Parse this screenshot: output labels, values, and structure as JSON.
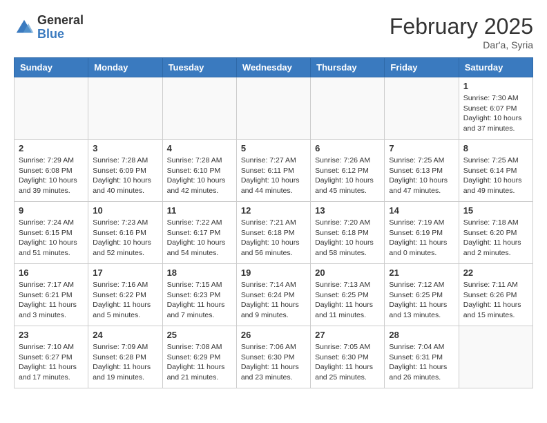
{
  "header": {
    "logo_general": "General",
    "logo_blue": "Blue",
    "month_year": "February 2025",
    "location": "Dar'a, Syria"
  },
  "weekdays": [
    "Sunday",
    "Monday",
    "Tuesday",
    "Wednesday",
    "Thursday",
    "Friday",
    "Saturday"
  ],
  "weeks": [
    [
      {
        "day": "",
        "info": ""
      },
      {
        "day": "",
        "info": ""
      },
      {
        "day": "",
        "info": ""
      },
      {
        "day": "",
        "info": ""
      },
      {
        "day": "",
        "info": ""
      },
      {
        "day": "",
        "info": ""
      },
      {
        "day": "1",
        "info": "Sunrise: 7:30 AM\nSunset: 6:07 PM\nDaylight: 10 hours\nand 37 minutes."
      }
    ],
    [
      {
        "day": "2",
        "info": "Sunrise: 7:29 AM\nSunset: 6:08 PM\nDaylight: 10 hours\nand 39 minutes."
      },
      {
        "day": "3",
        "info": "Sunrise: 7:28 AM\nSunset: 6:09 PM\nDaylight: 10 hours\nand 40 minutes."
      },
      {
        "day": "4",
        "info": "Sunrise: 7:28 AM\nSunset: 6:10 PM\nDaylight: 10 hours\nand 42 minutes."
      },
      {
        "day": "5",
        "info": "Sunrise: 7:27 AM\nSunset: 6:11 PM\nDaylight: 10 hours\nand 44 minutes."
      },
      {
        "day": "6",
        "info": "Sunrise: 7:26 AM\nSunset: 6:12 PM\nDaylight: 10 hours\nand 45 minutes."
      },
      {
        "day": "7",
        "info": "Sunrise: 7:25 AM\nSunset: 6:13 PM\nDaylight: 10 hours\nand 47 minutes."
      },
      {
        "day": "8",
        "info": "Sunrise: 7:25 AM\nSunset: 6:14 PM\nDaylight: 10 hours\nand 49 minutes."
      }
    ],
    [
      {
        "day": "9",
        "info": "Sunrise: 7:24 AM\nSunset: 6:15 PM\nDaylight: 10 hours\nand 51 minutes."
      },
      {
        "day": "10",
        "info": "Sunrise: 7:23 AM\nSunset: 6:16 PM\nDaylight: 10 hours\nand 52 minutes."
      },
      {
        "day": "11",
        "info": "Sunrise: 7:22 AM\nSunset: 6:17 PM\nDaylight: 10 hours\nand 54 minutes."
      },
      {
        "day": "12",
        "info": "Sunrise: 7:21 AM\nSunset: 6:18 PM\nDaylight: 10 hours\nand 56 minutes."
      },
      {
        "day": "13",
        "info": "Sunrise: 7:20 AM\nSunset: 6:18 PM\nDaylight: 10 hours\nand 58 minutes."
      },
      {
        "day": "14",
        "info": "Sunrise: 7:19 AM\nSunset: 6:19 PM\nDaylight: 11 hours\nand 0 minutes."
      },
      {
        "day": "15",
        "info": "Sunrise: 7:18 AM\nSunset: 6:20 PM\nDaylight: 11 hours\nand 2 minutes."
      }
    ],
    [
      {
        "day": "16",
        "info": "Sunrise: 7:17 AM\nSunset: 6:21 PM\nDaylight: 11 hours\nand 3 minutes."
      },
      {
        "day": "17",
        "info": "Sunrise: 7:16 AM\nSunset: 6:22 PM\nDaylight: 11 hours\nand 5 minutes."
      },
      {
        "day": "18",
        "info": "Sunrise: 7:15 AM\nSunset: 6:23 PM\nDaylight: 11 hours\nand 7 minutes."
      },
      {
        "day": "19",
        "info": "Sunrise: 7:14 AM\nSunset: 6:24 PM\nDaylight: 11 hours\nand 9 minutes."
      },
      {
        "day": "20",
        "info": "Sunrise: 7:13 AM\nSunset: 6:25 PM\nDaylight: 11 hours\nand 11 minutes."
      },
      {
        "day": "21",
        "info": "Sunrise: 7:12 AM\nSunset: 6:25 PM\nDaylight: 11 hours\nand 13 minutes."
      },
      {
        "day": "22",
        "info": "Sunrise: 7:11 AM\nSunset: 6:26 PM\nDaylight: 11 hours\nand 15 minutes."
      }
    ],
    [
      {
        "day": "23",
        "info": "Sunrise: 7:10 AM\nSunset: 6:27 PM\nDaylight: 11 hours\nand 17 minutes."
      },
      {
        "day": "24",
        "info": "Sunrise: 7:09 AM\nSunset: 6:28 PM\nDaylight: 11 hours\nand 19 minutes."
      },
      {
        "day": "25",
        "info": "Sunrise: 7:08 AM\nSunset: 6:29 PM\nDaylight: 11 hours\nand 21 minutes."
      },
      {
        "day": "26",
        "info": "Sunrise: 7:06 AM\nSunset: 6:30 PM\nDaylight: 11 hours\nand 23 minutes."
      },
      {
        "day": "27",
        "info": "Sunrise: 7:05 AM\nSunset: 6:30 PM\nDaylight: 11 hours\nand 25 minutes."
      },
      {
        "day": "28",
        "info": "Sunrise: 7:04 AM\nSunset: 6:31 PM\nDaylight: 11 hours\nand 26 minutes."
      },
      {
        "day": "",
        "info": ""
      }
    ]
  ]
}
